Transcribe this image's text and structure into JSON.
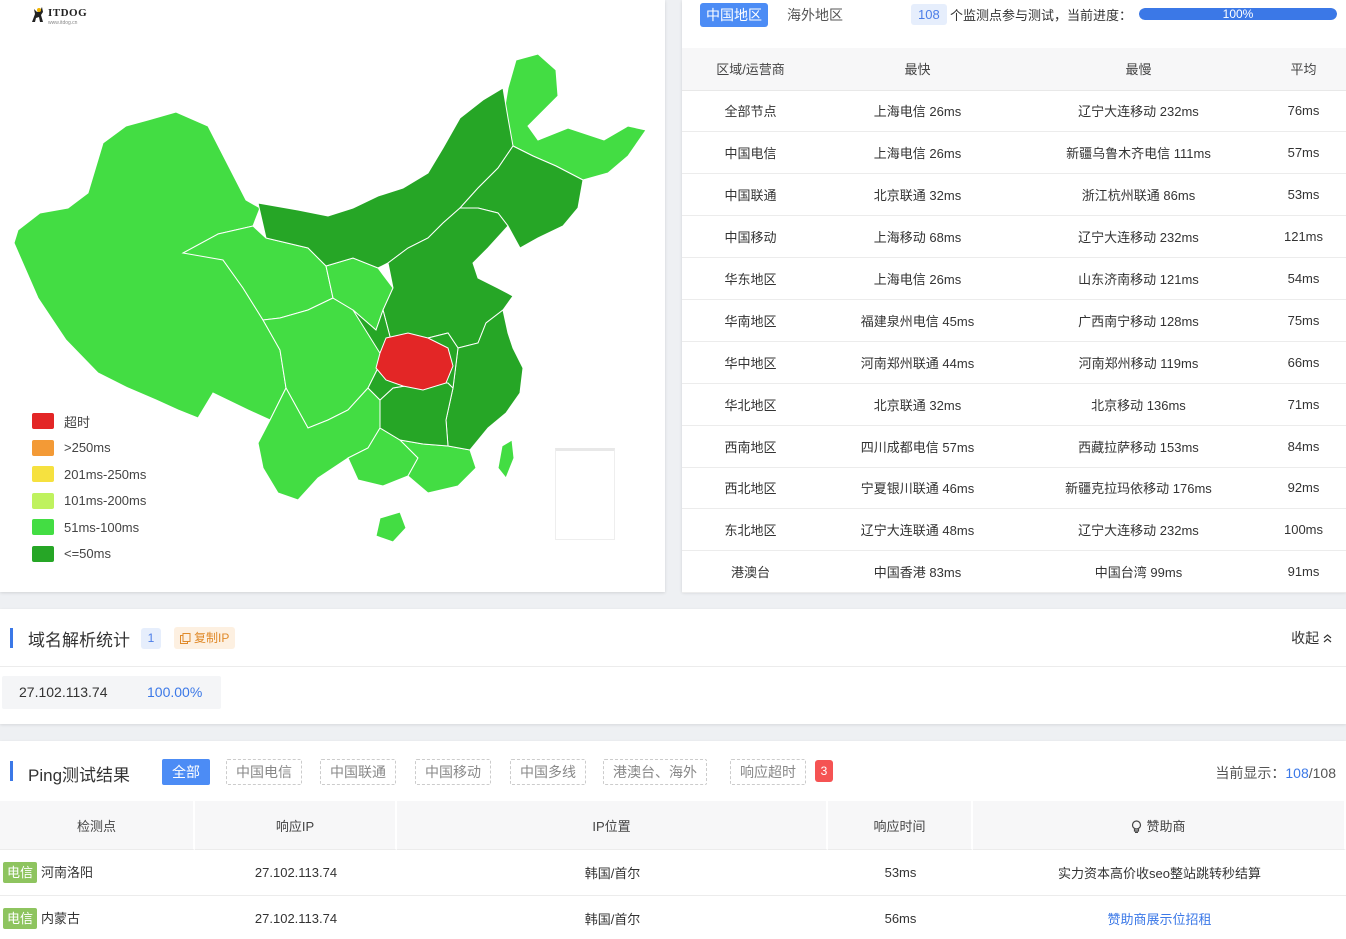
{
  "logo": {
    "brand": "ITDOG",
    "url": "www.itdog.cn"
  },
  "map": {
    "highlight_region": "湖北",
    "colors": {
      "timeout": "#e32626",
      "gt250": "#f39a36",
      "r201_250": "#f6e13f",
      "r101_200": "#bff25e",
      "r51_100": "#43dd43",
      "le50": "#26a626"
    },
    "legend": [
      {
        "label": "超时",
        "color": "#e32626"
      },
      {
        "label": ">250ms",
        "color": "#f39a36"
      },
      {
        "label": "201ms-250ms",
        "color": "#f6e13f"
      },
      {
        "label": "101ms-200ms",
        "color": "#bff25e"
      },
      {
        "label": "51ms-100ms",
        "color": "#43dd43"
      },
      {
        "label": "<=50ms",
        "color": "#26a626"
      }
    ]
  },
  "region_bar": {
    "tab_china": "中国地区",
    "tab_overseas": "海外地区",
    "node_count": "108",
    "node_text": "个监测点参与测试，当前进度：",
    "progress": 100,
    "progress_label": "100%"
  },
  "summary": {
    "headers": [
      "区域/运营商",
      "最快",
      "最慢",
      "平均"
    ],
    "rows": [
      [
        "全部节点",
        "上海电信 26ms",
        "辽宁大连移动 232ms",
        "76ms"
      ],
      [
        "中国电信",
        "上海电信 26ms",
        "新疆乌鲁木齐电信 111ms",
        "57ms"
      ],
      [
        "中国联通",
        "北京联通 32ms",
        "浙江杭州联通 86ms",
        "53ms"
      ],
      [
        "中国移动",
        "上海移动 68ms",
        "辽宁大连移动 232ms",
        "121ms"
      ],
      [
        "华东地区",
        "上海电信 26ms",
        "山东济南移动 121ms",
        "54ms"
      ],
      [
        "华南地区",
        "福建泉州电信 45ms",
        "广西南宁移动 128ms",
        "75ms"
      ],
      [
        "华中地区",
        "河南郑州联通 44ms",
        "河南郑州移动 119ms",
        "66ms"
      ],
      [
        "华北地区",
        "北京联通 32ms",
        "北京移动 136ms",
        "71ms"
      ],
      [
        "西南地区",
        "四川成都电信 57ms",
        "西藏拉萨移动 153ms",
        "84ms"
      ],
      [
        "西北地区",
        "宁夏银川联通 46ms",
        "新疆克拉玛依移动 176ms",
        "92ms"
      ],
      [
        "东北地区",
        "辽宁大连联通 48ms",
        "辽宁大连移动 232ms",
        "100ms"
      ],
      [
        "港澳台",
        "中国香港 83ms",
        "中国台湾 99ms",
        "91ms"
      ]
    ]
  },
  "dns": {
    "title": "域名解析统计",
    "count": "1",
    "copy_label": "复制IP",
    "collapse_label": "收起",
    "ip": "27.102.113.74",
    "percent": "100.00%"
  },
  "ping": {
    "title": "Ping测试结果",
    "filters": [
      "全部",
      "中国电信",
      "中国联通",
      "中国移动",
      "中国多线",
      "港澳台、海外",
      "响应超时"
    ],
    "timeout_count": "3",
    "current_label": "当前显示：",
    "current_shown": "108",
    "current_total": "/108",
    "headers": [
      "检测点",
      "响应IP",
      "IP位置",
      "响应时间",
      "赞助商"
    ],
    "rows": [
      {
        "isp": "电信",
        "node": "河南洛阳",
        "ip": "27.102.113.74",
        "location": "韩国/首尔",
        "time": "53ms",
        "sponsor": "实力资本高价收seo整站跳转秒结算"
      },
      {
        "isp": "电信",
        "node": "内蒙古",
        "ip": "27.102.113.74",
        "location": "韩国/首尔",
        "time": "56ms",
        "sponsor": "赞助商展示位招租"
      }
    ]
  }
}
